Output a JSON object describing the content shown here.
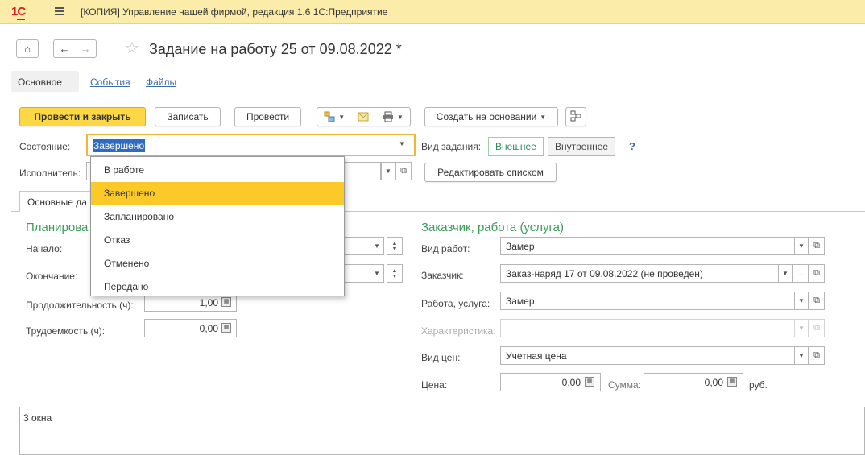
{
  "app": {
    "title": "[КОПИЯ] Управление нашей фирмой, редакция 1.6 1С:Предприятие"
  },
  "nav": {
    "home_glyph": "⌂",
    "back_glyph": "←",
    "forward_glyph": "→",
    "star_glyph": "☆"
  },
  "document": {
    "title": "Задание на работу 25 от 09.08.2022 *"
  },
  "tabs": [
    {
      "label": "Основное"
    },
    {
      "label": "События"
    },
    {
      "label": "Файлы"
    }
  ],
  "toolbar": {
    "post_close": "Провести и закрыть",
    "save": "Записать",
    "post": "Провести",
    "create_based": "Создать на основании"
  },
  "state": {
    "label": "Состояние:",
    "value": "Завершено"
  },
  "task_kind": {
    "label": "Вид задания:",
    "external": "Внешнее",
    "internal": "Внутреннее",
    "help": "?"
  },
  "executor": {
    "label": "Исполнитель:",
    "edit_list": "Редактировать списком"
  },
  "dropdown": {
    "options": [
      {
        "label": "В работе"
      },
      {
        "label": "Завершено"
      },
      {
        "label": "Запланировано"
      },
      {
        "label": "Отказ"
      },
      {
        "label": "Отменено"
      },
      {
        "label": "Передано"
      }
    ],
    "selected": "Завершено"
  },
  "inner_tab": {
    "label": "Основные да"
  },
  "planning": {
    "heading": "Планирова",
    "start_label": "Начало:",
    "end_label": "Окончание:",
    "duration_label": "Продолжительность (ч):",
    "duration_value": "1,00",
    "labor_label": "Трудоемкость (ч):",
    "labor_value": "0,00"
  },
  "customer": {
    "heading": "Заказчик, работа (услуга)",
    "work_kind_label": "Вид работ:",
    "work_kind_value": "Замер",
    "customer_label": "Заказчик:",
    "customer_value": "Заказ-наряд 17 от 09.08.2022 (не проведен)",
    "work_label": "Работа, услуга:",
    "work_value": "Замер",
    "characteristic_label": "Характеристика:",
    "price_kind_label": "Вид цен:",
    "price_kind_value": "Учетная цена",
    "price_label": "Цена:",
    "price_value": "0,00",
    "sum_label": "Сумма:",
    "sum_value": "0,00",
    "currency": "руб."
  },
  "memo": {
    "text": "3 окна"
  },
  "colors": {
    "titlebar": "#fbeda9",
    "primary_button": "#fcd844",
    "dropdown_highlight": "#fbca28",
    "section_heading": "#3e9a5a",
    "link": "#3f6aa8",
    "focus_border": "#f0b830"
  }
}
